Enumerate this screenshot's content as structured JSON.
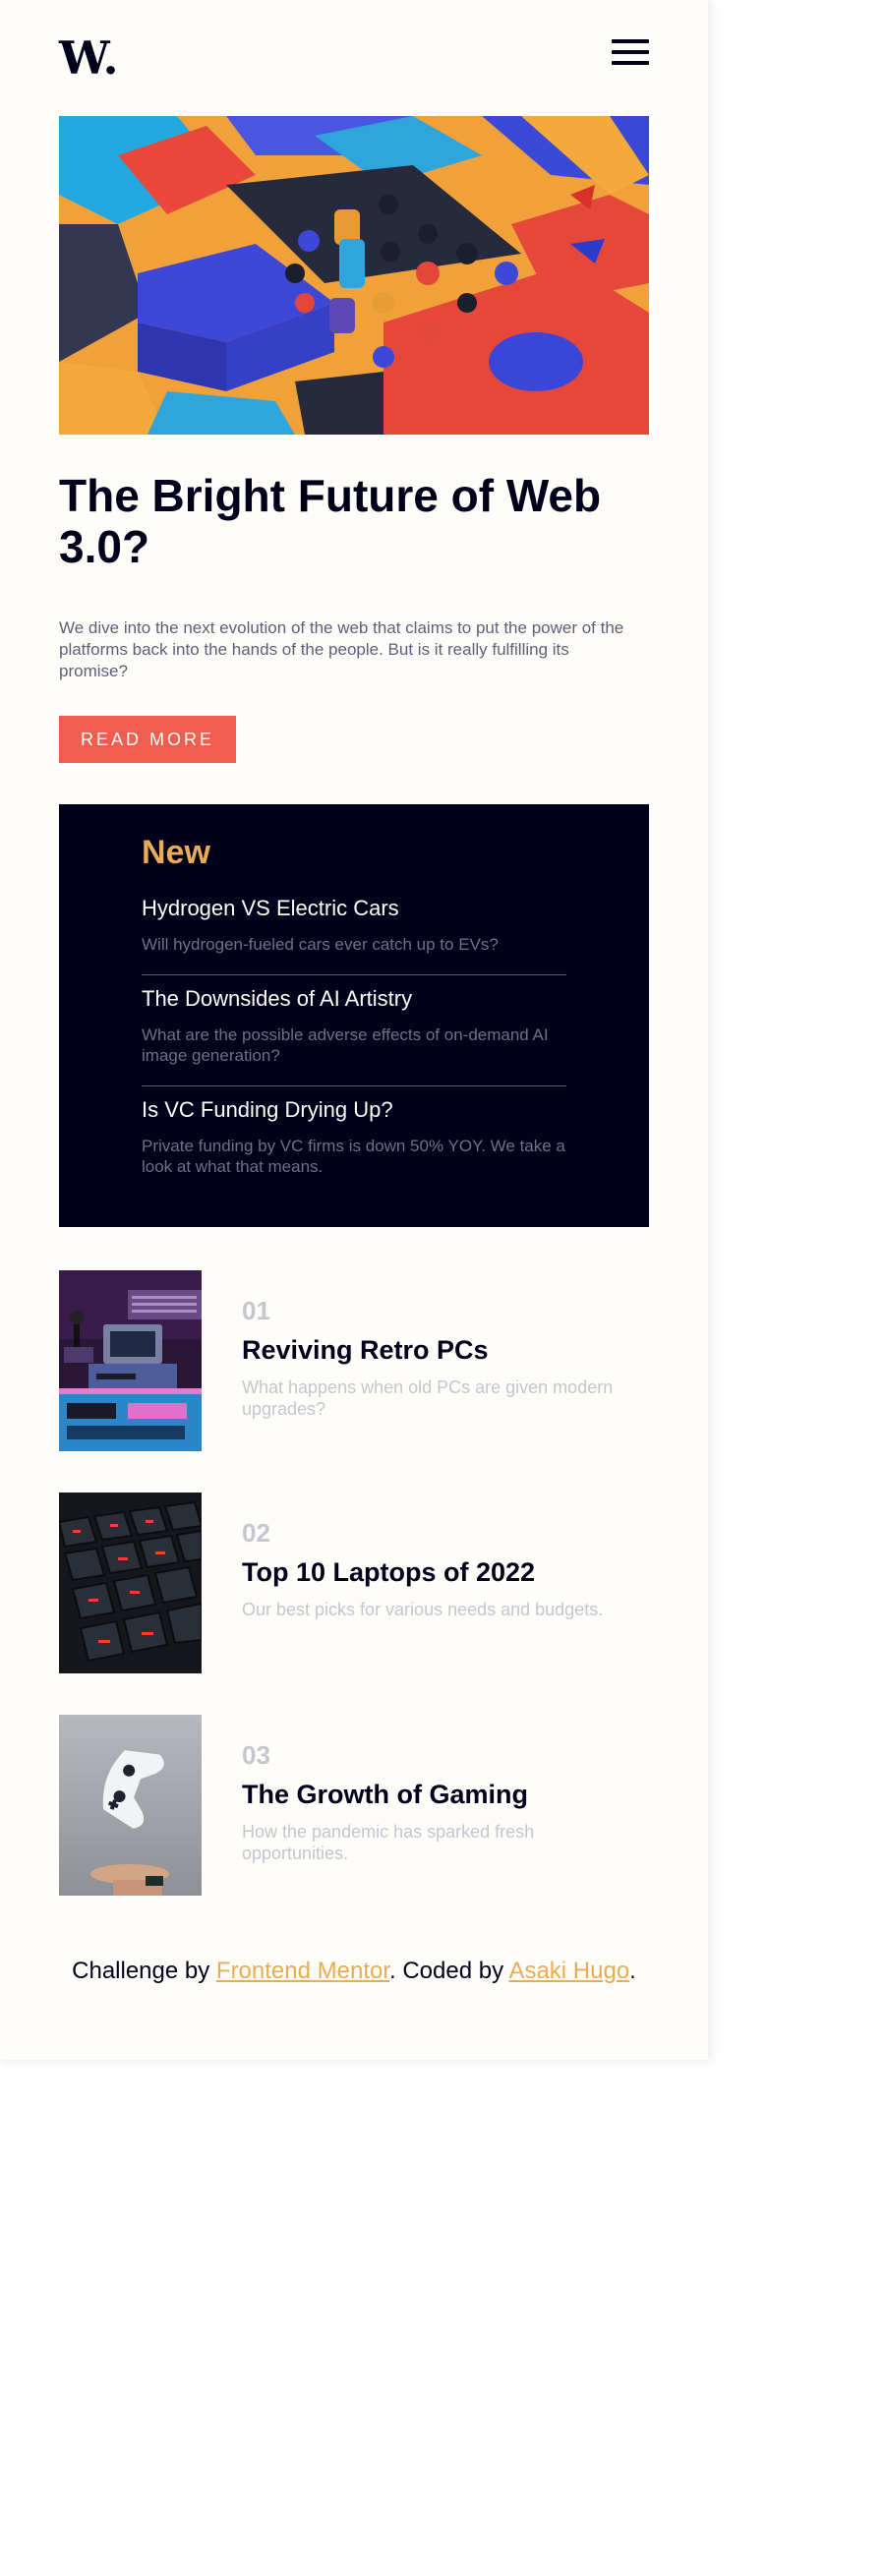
{
  "header": {
    "logo": "W.",
    "menu_icon": "hamburger-menu-icon"
  },
  "hero": {
    "image": "colorful-3d-blocks-illustration",
    "title": "The Bright Future of Web 3.0?",
    "description": "We dive into the next evolution of the web that claims to put the power of the platforms back into the hands of the people. But is it really fulfilling its promise?",
    "button_label": "READ MORE"
  },
  "new_section": {
    "heading": "New",
    "items": [
      {
        "title": "Hydrogen VS Electric Cars",
        "text": "Will hydrogen-fueled cars ever catch up to EVs?"
      },
      {
        "title": "The Downsides of AI Artistry",
        "text": "What are the possible adverse effects of on-demand AI image generation?"
      },
      {
        "title": "Is VC Funding Drying Up?",
        "text": "Private funding by VC firms is down 50% YOY. We take a look at what that means."
      }
    ]
  },
  "articles": [
    {
      "number": "01",
      "title": "Reviving Retro PCs",
      "text": "What happens when old PCs are given modern upgrades?",
      "image": "retro-pc-image"
    },
    {
      "number": "02",
      "title": "Top 10 Laptops of 2022",
      "text": "Our best picks for various needs and budgets.",
      "image": "laptop-keyboard-image"
    },
    {
      "number": "03",
      "title": "The Growth of Gaming",
      "text": "How the pandemic has sparked fresh opportunities.",
      "image": "game-controller-image"
    }
  ],
  "footer": {
    "prefix": "Challenge by ",
    "link1": "Frontend Mentor",
    "middle": ". Coded by ",
    "link2": "Asaki Hugo",
    "suffix": "."
  },
  "colors": {
    "accent_red": "#f15e50",
    "accent_orange": "#e9ab53",
    "dark_navy": "#00001a",
    "off_white": "#fffdfa",
    "grayish_blue": "#5d5f79"
  }
}
